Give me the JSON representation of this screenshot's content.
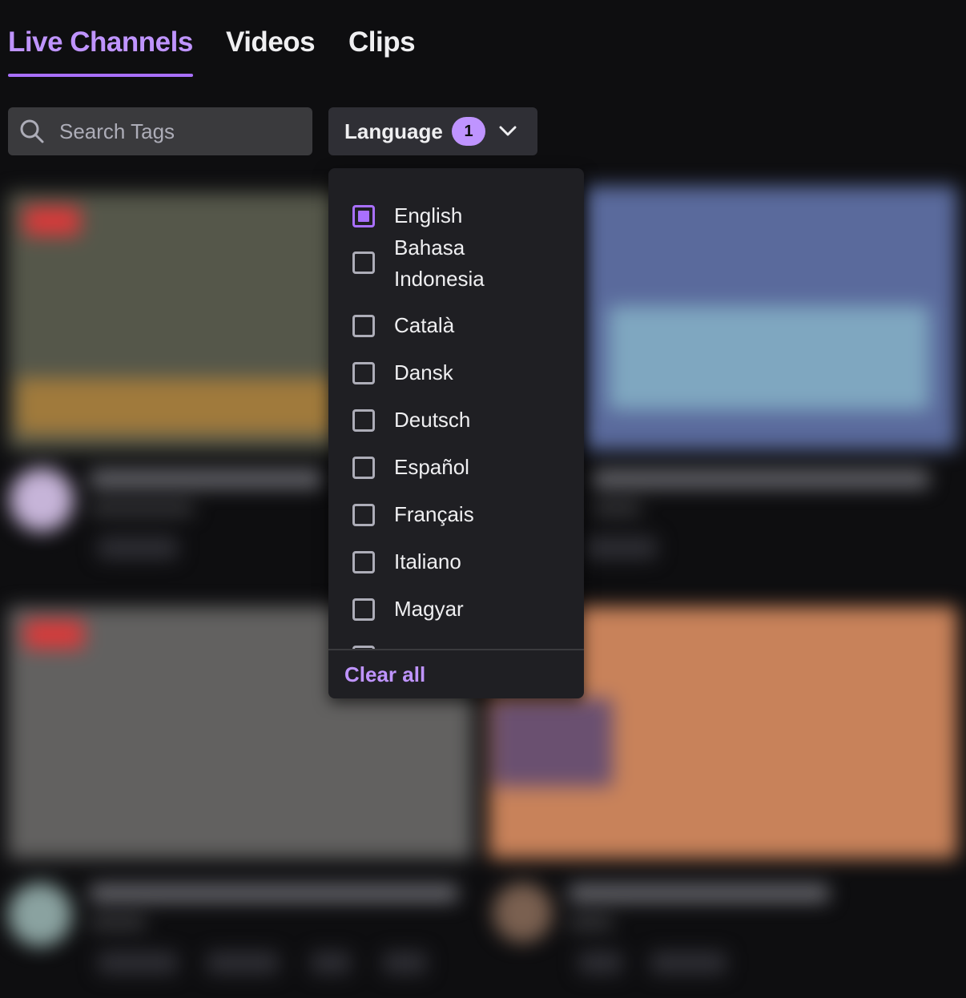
{
  "tabs": [
    {
      "label": "Live Channels",
      "active": true
    },
    {
      "label": "Videos",
      "active": false
    },
    {
      "label": "Clips",
      "active": false
    }
  ],
  "search": {
    "placeholder": "Search Tags",
    "icon": "search-icon"
  },
  "language_filter": {
    "label": "Language",
    "count": "1",
    "icon": "chevron-down-icon"
  },
  "languages": [
    {
      "label": "English",
      "checked": true
    },
    {
      "label": "Bahasa Indonesia",
      "checked": false
    },
    {
      "label": "Català",
      "checked": false
    },
    {
      "label": "Dansk",
      "checked": false
    },
    {
      "label": "Deutsch",
      "checked": false
    },
    {
      "label": "Español",
      "checked": false
    },
    {
      "label": "Français",
      "checked": false
    },
    {
      "label": "Italiano",
      "checked": false
    },
    {
      "label": "Magyar",
      "checked": false
    }
  ],
  "clear_all": "Clear all",
  "colors": {
    "accent": "#a970ff",
    "accent_text": "#bf94ff",
    "background": "#0e0e10",
    "panel": "#1f1f23"
  }
}
